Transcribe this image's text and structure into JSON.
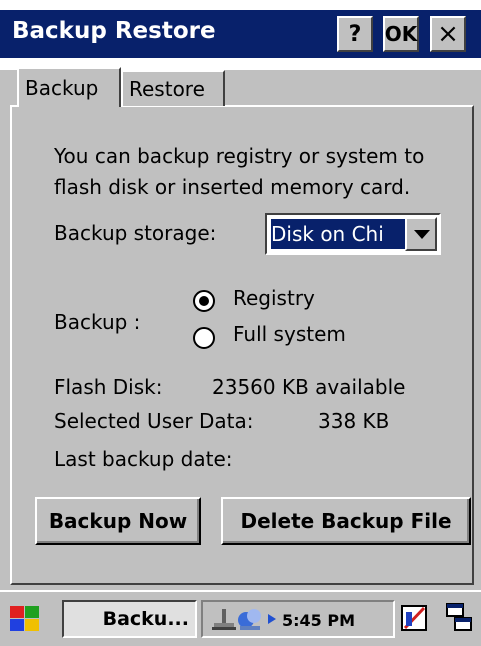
{
  "window": {
    "title": "Backup Restore",
    "help_label": "?",
    "ok_label": "OK",
    "close_label": "×"
  },
  "tabs": [
    {
      "label": "Backup",
      "active": true
    },
    {
      "label": "Restore",
      "active": false
    }
  ],
  "backup": {
    "description_line1": "You can backup registry or system to",
    "description_line2": "flash disk or inserted memory card.",
    "storage_label": "Backup storage:",
    "storage_value": "Disk on Chi",
    "backup_label": "Backup :",
    "options": [
      {
        "label": "Registry",
        "checked": true
      },
      {
        "label": "Full system",
        "checked": false
      }
    ],
    "flash_disk_label": "Flash Disk:",
    "flash_disk_value": "23560 KB available",
    "user_data_label": "Selected User Data:",
    "user_data_value": "338 KB",
    "last_backup_label": "Last backup date:",
    "backup_now_label": "Backup Now",
    "delete_label": "Delete Backup File"
  },
  "taskbar": {
    "task_label": "Backu...",
    "clock": "5:45 PM"
  },
  "colors": {
    "title_bar": "#08216b",
    "face": "#c0c0c0"
  }
}
